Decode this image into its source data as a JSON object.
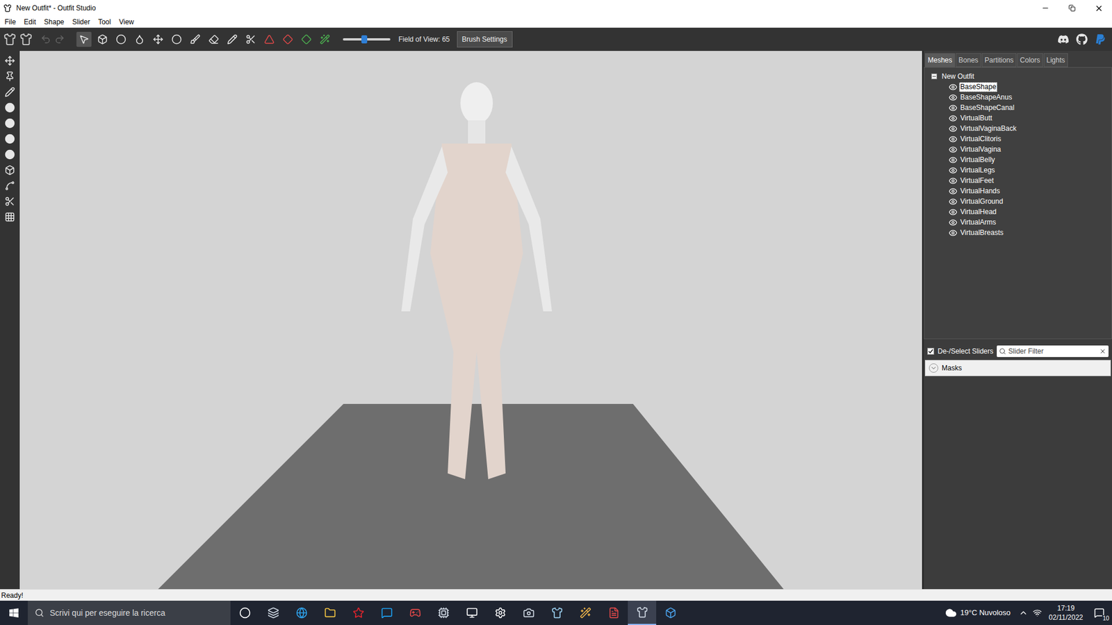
{
  "window": {
    "title": "New Outfit* - Outfit Studio"
  },
  "menu": [
    "File",
    "Edit",
    "Shape",
    "Slider",
    "Tool",
    "View"
  ],
  "toolbar": {
    "fov_slider_level": 0.45,
    "field_of_view": "Field of View: 65",
    "brush_settings": "Brush Settings"
  },
  "panel_tabs": [
    {
      "label": "Meshes",
      "selected": true
    },
    {
      "label": "Bones",
      "selected": false
    },
    {
      "label": "Partitions",
      "selected": false
    },
    {
      "label": "Colors",
      "selected": false
    },
    {
      "label": "Lights",
      "selected": false
    }
  ],
  "tree": {
    "root": "New Outfit",
    "expanded": true,
    "items": [
      {
        "label": "BaseShape",
        "selected": true
      },
      {
        "label": "BaseShapeAnus",
        "selected": false
      },
      {
        "label": "BaseShapeCanal",
        "selected": false
      },
      {
        "label": "VirtualButt",
        "selected": false
      },
      {
        "label": "VirtualVaginaBack",
        "selected": false
      },
      {
        "label": "VirtualClitoris",
        "selected": false
      },
      {
        "label": "VirtualVagina",
        "selected": false
      },
      {
        "label": "VirtualBelly",
        "selected": false
      },
      {
        "label": "VirtualLegs",
        "selected": false
      },
      {
        "label": "VirtualFeet",
        "selected": false
      },
      {
        "label": "VirtualHands",
        "selected": false
      },
      {
        "label": "VirtualGround",
        "selected": false
      },
      {
        "label": "VirtualHead",
        "selected": false
      },
      {
        "label": "VirtualArms",
        "selected": false
      },
      {
        "label": "VirtualBreasts",
        "selected": false
      }
    ]
  },
  "sliders": {
    "select_all": {
      "label": "De-/Select Sliders",
      "checked": true
    },
    "filter_placeholder": "Slider Filter",
    "groups": [
      {
        "label": "Masks",
        "expanded": false
      }
    ]
  },
  "status_bar": "Ready!",
  "taskbar": {
    "search_placeholder": "Scrivi qui per eseguire la ricerca",
    "weather": "19°C Nuvoloso",
    "time": "17:19",
    "date": "02/11/2022",
    "notifications": "10"
  }
}
